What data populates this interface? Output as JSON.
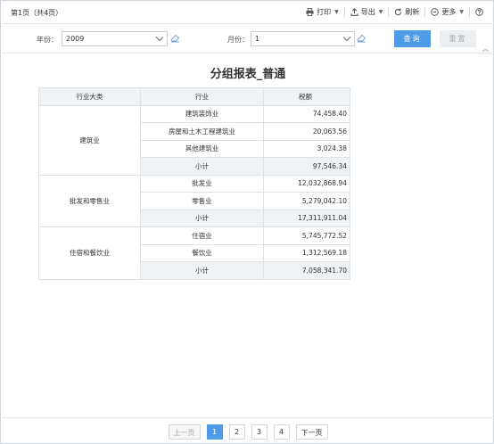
{
  "toolbar": {
    "page_info": "第1页（共4页）",
    "print_label": "打印",
    "export_label": "导出",
    "refresh_label": "刷新",
    "more_label": "更多"
  },
  "filters": {
    "year_label": "年份：",
    "year_value": "2009",
    "month_label": "月份：",
    "month_value": "1",
    "query_label": "查询",
    "reset_label": "重置"
  },
  "report": {
    "title": "分组报表_普通",
    "headers": [
      "行业大类",
      "行业",
      "税额"
    ],
    "groups": [
      {
        "category": "建筑业",
        "rows": [
          {
            "industry": "建筑装饰业",
            "tax": "74,458.40"
          },
          {
            "industry": "房屋和土木工程建筑业",
            "tax": "20,063.56"
          },
          {
            "industry": "其他建筑业",
            "tax": "3,024.38"
          }
        ],
        "subtotal_label": "小计",
        "subtotal": "97,546.34"
      },
      {
        "category": "批发和零售业",
        "rows": [
          {
            "industry": "批发业",
            "tax": "12,032,868.94"
          },
          {
            "industry": "零售业",
            "tax": "5,279,042.10"
          }
        ],
        "subtotal_label": "小计",
        "subtotal": "17,311,911.04"
      },
      {
        "category": "住宿和餐饮业",
        "rows": [
          {
            "industry": "住宿业",
            "tax": "5,745,772.52"
          },
          {
            "industry": "餐饮业",
            "tax": "1,312,569.18"
          }
        ],
        "subtotal_label": "小计",
        "subtotal": "7,058,341.70"
      }
    ]
  },
  "pagination": {
    "prev_label": "上一页",
    "pages": [
      "1",
      "2",
      "3",
      "4"
    ],
    "current_page": "1",
    "next_label": "下一页"
  },
  "colors": {
    "accent": "#4e9be8",
    "header_bg": "#eff3f6"
  }
}
